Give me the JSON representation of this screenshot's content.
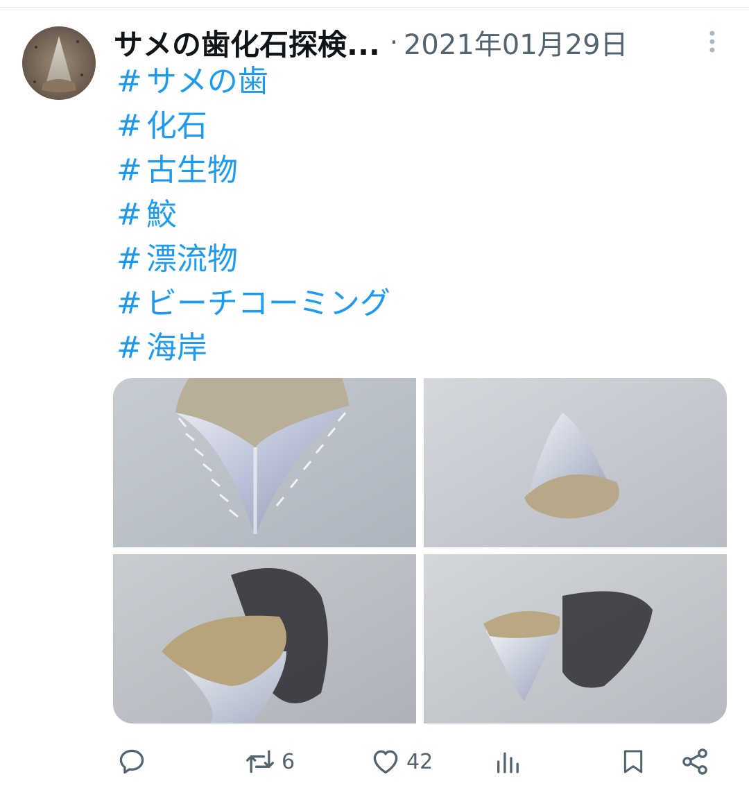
{
  "tweet": {
    "display_name": "サメの歯化石探検...",
    "separator": "·",
    "date": "2021年01月29日",
    "hashtags": [
      {
        "hash": "#",
        "text": "サメの歯"
      },
      {
        "hash": "#",
        "text": "化石"
      },
      {
        "hash": "#",
        "text": "古生物"
      },
      {
        "hash": "#",
        "text": "鮫"
      },
      {
        "hash": "#",
        "text": "漂流物"
      },
      {
        "hash": "#",
        "text": "ビーチコーミング"
      },
      {
        "hash": "#",
        "text": "海岸"
      }
    ],
    "media_count": 4
  },
  "actions": {
    "reply": {
      "icon": "reply-icon",
      "count": ""
    },
    "retweet": {
      "icon": "retweet-icon",
      "count": "6"
    },
    "like": {
      "icon": "heart-icon",
      "count": "42"
    },
    "views": {
      "icon": "analytics-icon",
      "count": ""
    },
    "bookmark": {
      "icon": "bookmark-icon"
    },
    "share": {
      "icon": "share-icon"
    }
  },
  "colors": {
    "link": "#1d9bf0",
    "text_primary": "#0f1419",
    "text_secondary": "#536471"
  }
}
